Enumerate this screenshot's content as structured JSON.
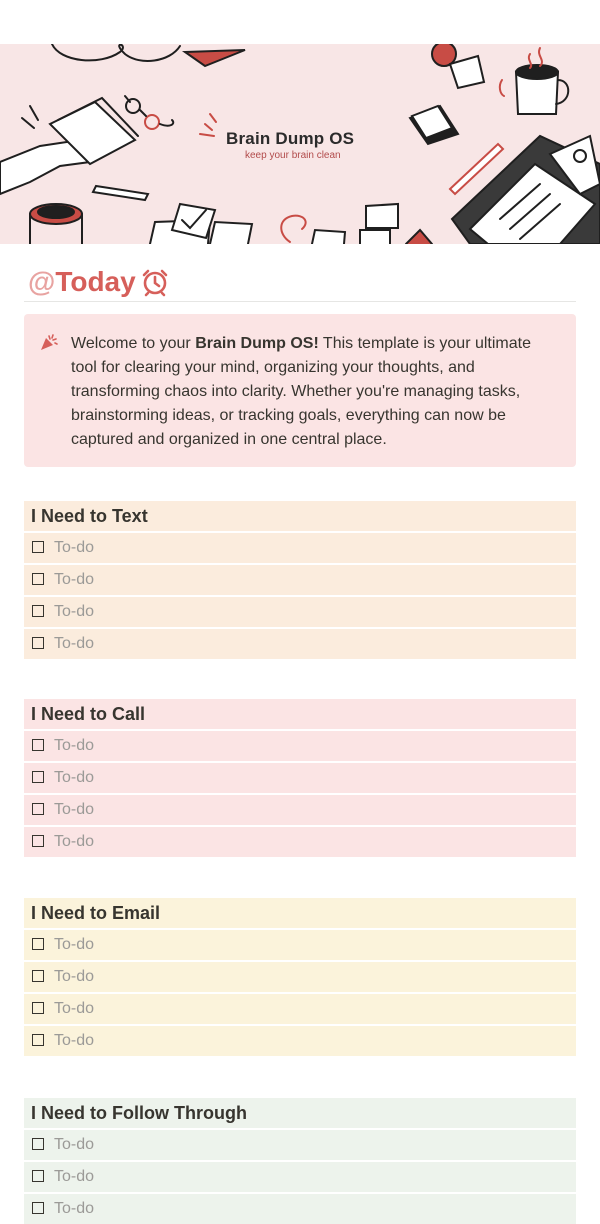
{
  "banner": {
    "title": "Brain Dump OS",
    "subtitle": "keep your brain clean"
  },
  "page": {
    "title_prefix": "@",
    "title": "Today",
    "title_icon": "alarm-clock-icon"
  },
  "callout": {
    "icon": "party-popper-icon",
    "intro": "Welcome to your ",
    "bold": "Brain Dump OS!",
    "body": " This template is your ultimate tool for clearing your mind, organizing your thoughts, and transforming chaos into clarity. Whether you're managing tasks, brainstorming ideas, or tracking goals, everything can now be captured and organized in one central place."
  },
  "sections": [
    {
      "title": "I Need to Text",
      "color": "#fbecdd",
      "todos": [
        "To-do",
        "To-do",
        "To-do",
        "To-do"
      ]
    },
    {
      "title": "I Need to Call",
      "color": "#fbe4e4",
      "todos": [
        "To-do",
        "To-do",
        "To-do",
        "To-do"
      ]
    },
    {
      "title": "I Need to Email",
      "color": "#fbf3db",
      "todos": [
        "To-do",
        "To-do",
        "To-do",
        "To-do"
      ]
    },
    {
      "title": "I Need to Follow Through",
      "color": "#edf3ec",
      "todos": [
        "To-do",
        "To-do",
        "To-do"
      ]
    }
  ],
  "colors": {
    "accent": "#d65f5a",
    "banner_bg": "#f8e6e6",
    "callout_bg": "#fbe4e4"
  }
}
